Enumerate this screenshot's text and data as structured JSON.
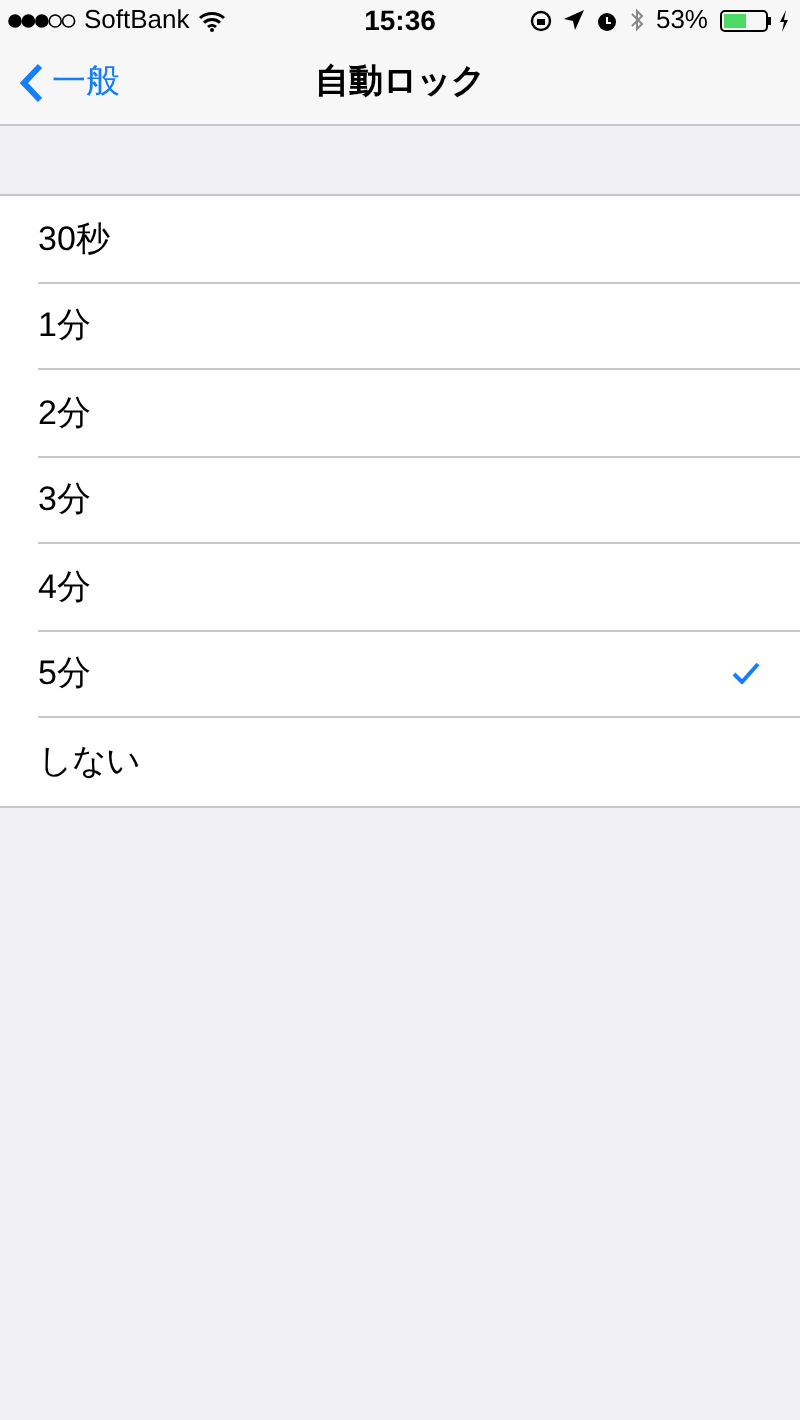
{
  "status_bar": {
    "carrier": "SoftBank",
    "time": "15:36",
    "battery_percent": "53%"
  },
  "nav": {
    "back": "一般",
    "title": "自動ロック"
  },
  "options": [
    {
      "label": "30秒",
      "selected": false
    },
    {
      "label": "1分",
      "selected": false
    },
    {
      "label": "2分",
      "selected": false
    },
    {
      "label": "3分",
      "selected": false
    },
    {
      "label": "4分",
      "selected": false
    },
    {
      "label": "5分",
      "selected": true
    },
    {
      "label": "しない",
      "selected": false
    }
  ]
}
